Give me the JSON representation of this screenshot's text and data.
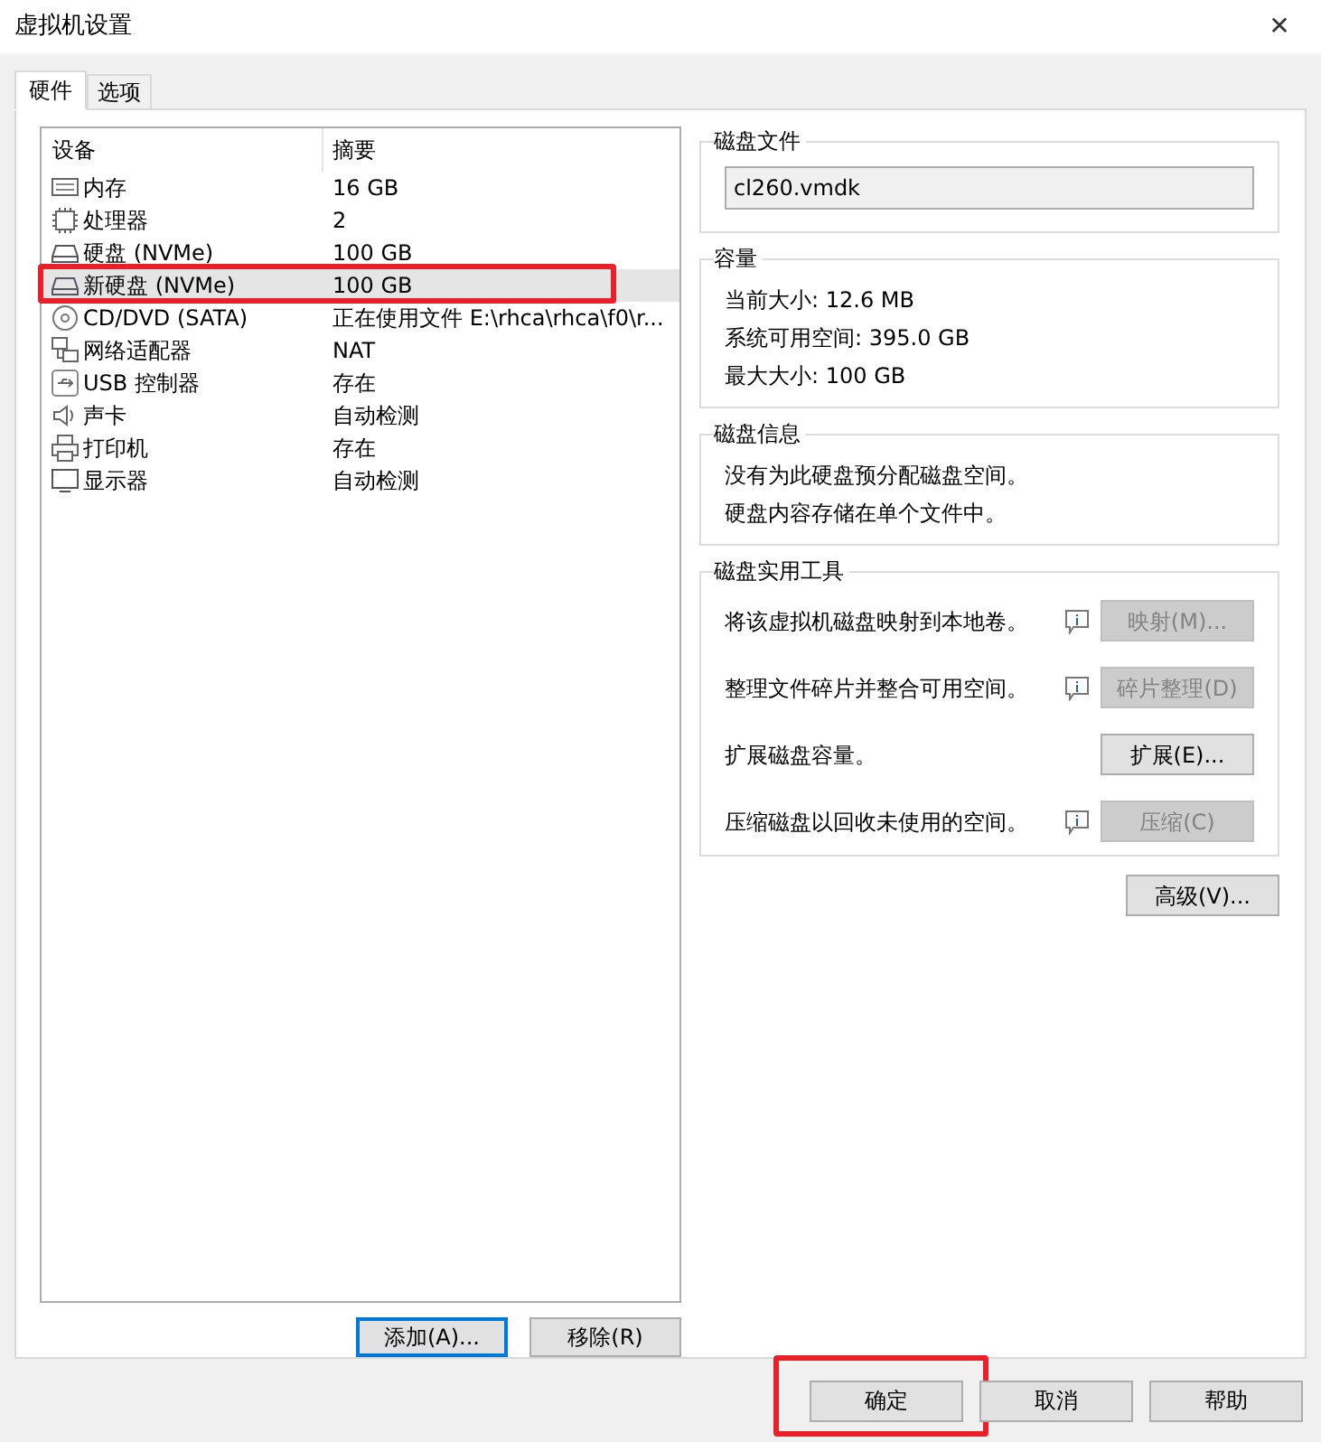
{
  "window": {
    "title": "虚拟机设置",
    "close": "✕"
  },
  "tabs": [
    {
      "label": "硬件",
      "selected": true
    },
    {
      "label": "选项",
      "selected": false
    }
  ],
  "device_table": {
    "columns": [
      "设备",
      "摘要"
    ],
    "rows": [
      {
        "kind": "memory",
        "device": "内存",
        "summary": "16 GB",
        "selected": false,
        "annotated": false
      },
      {
        "kind": "cpu",
        "device": "处理器",
        "summary": "2",
        "selected": false,
        "annotated": false
      },
      {
        "kind": "disk",
        "device": "硬盘 (NVMe)",
        "summary": "100 GB",
        "selected": false,
        "annotated": false
      },
      {
        "kind": "disk",
        "device": "新硬盘 (NVMe)",
        "summary": "100 GB",
        "selected": true,
        "annotated": true
      },
      {
        "kind": "cdrom",
        "device": "CD/DVD (SATA)",
        "summary": "正在使用文件 E:\\rhca\\rhca\\f0\\r...",
        "selected": false,
        "annotated": false
      },
      {
        "kind": "network",
        "device": "网络适配器",
        "summary": "NAT",
        "selected": false,
        "annotated": false
      },
      {
        "kind": "usb",
        "device": "USB 控制器",
        "summary": "存在",
        "selected": false,
        "annotated": false
      },
      {
        "kind": "sound",
        "device": "声卡",
        "summary": "自动检测",
        "selected": false,
        "annotated": false
      },
      {
        "kind": "printer",
        "device": "打印机",
        "summary": "存在",
        "selected": false,
        "annotated": false
      },
      {
        "kind": "display",
        "device": "显示器",
        "summary": "自动检测",
        "selected": false,
        "annotated": false
      }
    ]
  },
  "list_buttons": [
    {
      "label": "添加(A)...",
      "focused": true
    },
    {
      "label": "移除(R)",
      "focused": false
    }
  ],
  "disk_file": {
    "title": "磁盘文件",
    "value": "cl260.vmdk"
  },
  "capacity": {
    "title": "容量",
    "lines": [
      "当前大小: 12.6 MB",
      "系统可用空间: 395.0 GB",
      "最大大小: 100 GB"
    ]
  },
  "disk_info": {
    "title": "磁盘信息",
    "lines": [
      "没有为此硬盘预分配磁盘空间。",
      "硬盘内容存储在单个文件中。"
    ]
  },
  "disk_utilities": {
    "title": "磁盘实用工具",
    "items": [
      {
        "text": "将该虚拟机磁盘映射到本地卷。",
        "info": true,
        "button": "映射(M)...",
        "disabled": true
      },
      {
        "text": "整理文件碎片并整合可用空间。",
        "info": true,
        "button": "碎片整理(D)",
        "disabled": true
      },
      {
        "text": "扩展磁盘容量。",
        "info": false,
        "button": "扩展(E)...",
        "disabled": false
      },
      {
        "text": "压缩磁盘以回收未使用的空间。",
        "info": true,
        "button": "压缩(C)",
        "disabled": true
      }
    ]
  },
  "advanced_button": "高级(V)...",
  "dialog_buttons": [
    {
      "label": "确定",
      "annotated": true
    },
    {
      "label": "取消",
      "annotated": false
    },
    {
      "label": "帮助",
      "annotated": false
    }
  ]
}
